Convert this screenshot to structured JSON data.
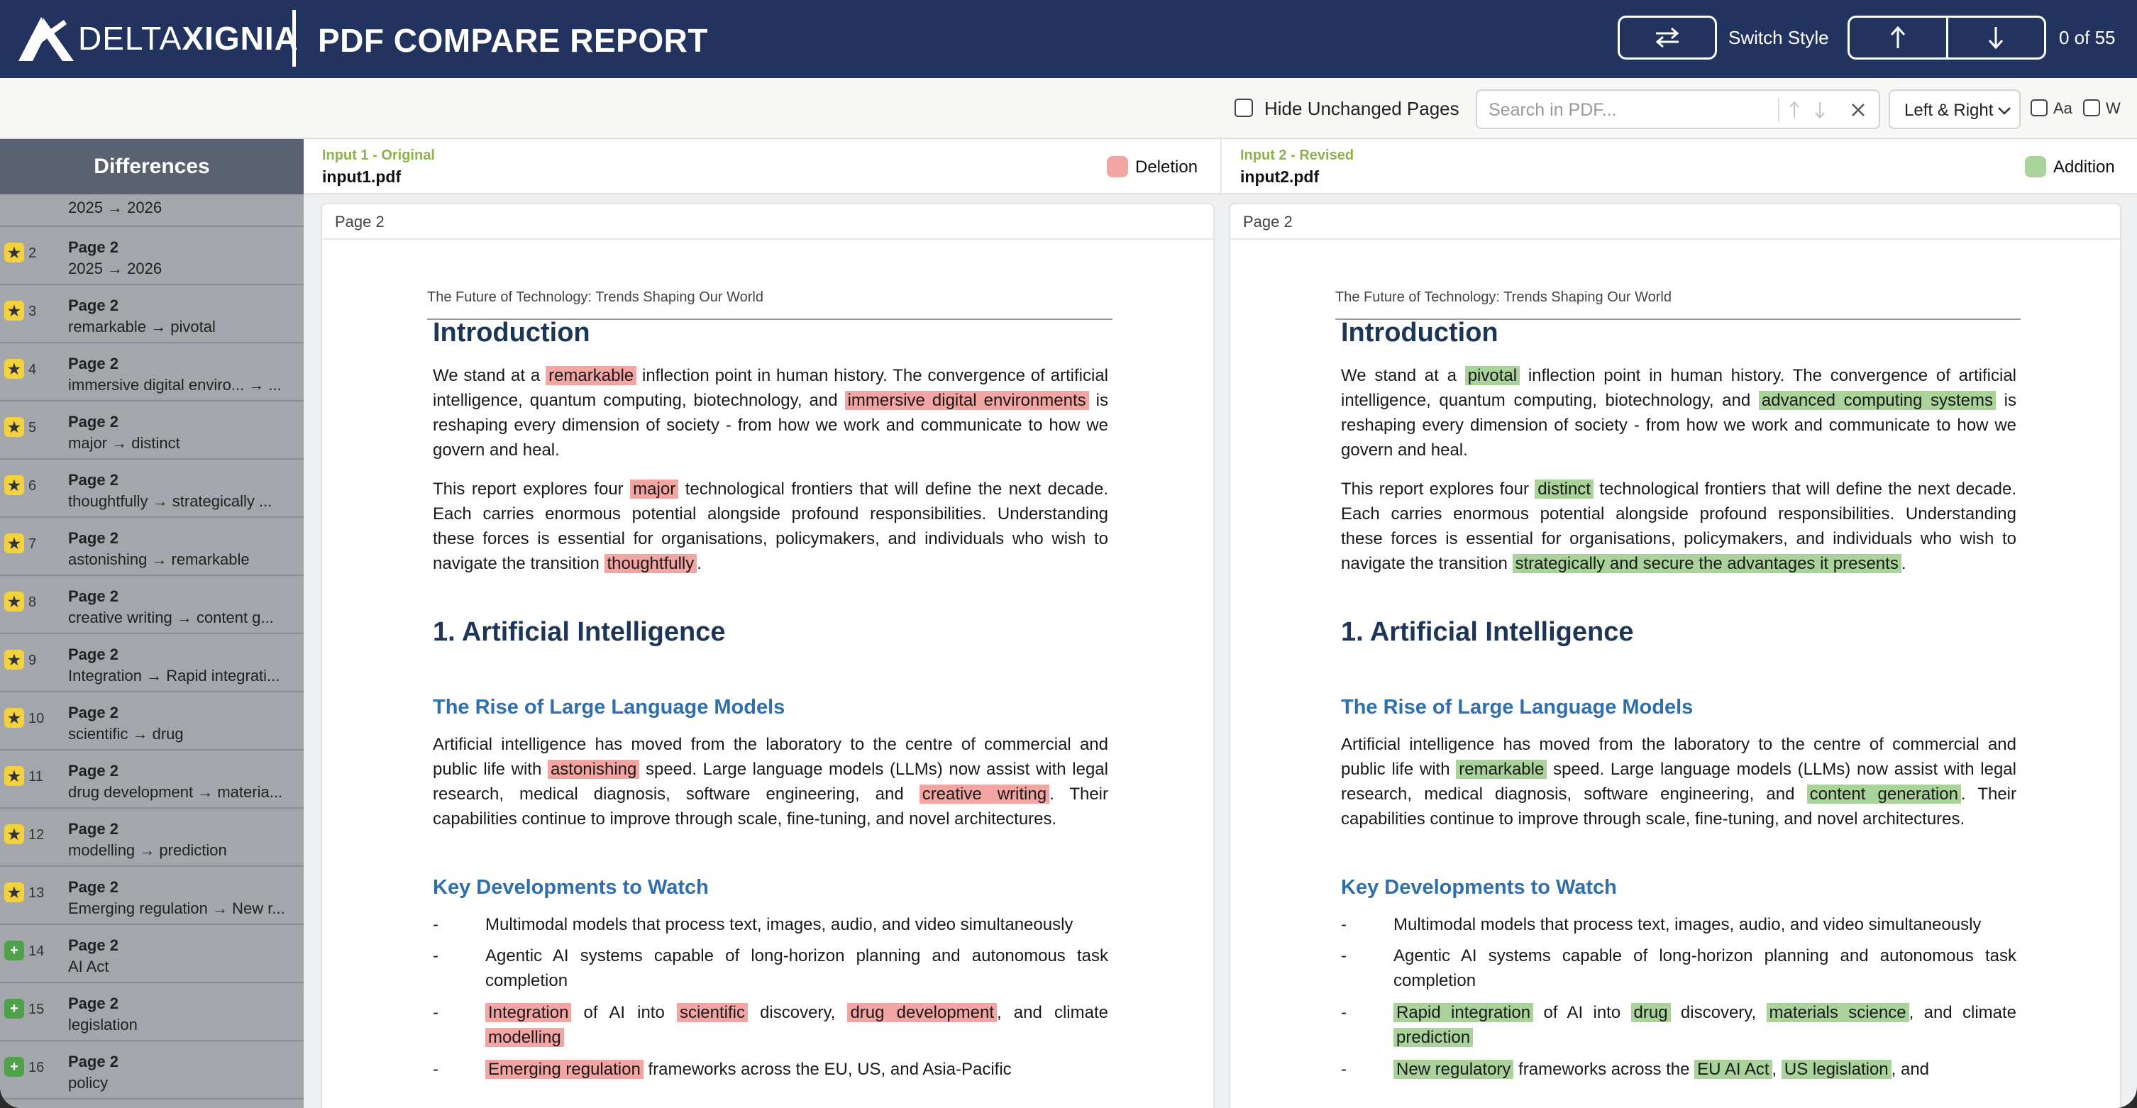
{
  "header": {
    "logo_light": "DELTA",
    "logo_bold": "XIGNIA",
    "title": "PDF COMPARE REPORT",
    "switch_style_label": "Switch Style",
    "counter": "0 of 55",
    "bg_color": "#23335f"
  },
  "toolbar": {
    "hide_unchanged_label": "Hide Unchanged Pages",
    "hide_unchanged_checked": false,
    "search_placeholder": "Search in PDF...",
    "view_mode": "Left & Right",
    "match_case_label": "Aa",
    "whole_word_label": "W"
  },
  "sidebar": {
    "title": "Differences",
    "cut_item_desc": "2025 → 2026",
    "items": [
      {
        "num": "2",
        "page": "Page 2",
        "desc": "2025 → 2026",
        "type": "change"
      },
      {
        "num": "3",
        "page": "Page 2",
        "desc": "remarkable → pivotal",
        "type": "change"
      },
      {
        "num": "4",
        "page": "Page 2",
        "desc": "immersive digital enviro... → ...",
        "type": "change"
      },
      {
        "num": "5",
        "page": "Page 2",
        "desc": "major → distinct",
        "type": "change"
      },
      {
        "num": "6",
        "page": "Page 2",
        "desc": "thoughtfully → strategically ...",
        "type": "change"
      },
      {
        "num": "7",
        "page": "Page 2",
        "desc": "astonishing → remarkable",
        "type": "change"
      },
      {
        "num": "8",
        "page": "Page 2",
        "desc": "creative writing → content g...",
        "type": "change"
      },
      {
        "num": "9",
        "page": "Page 2",
        "desc": "Integration → Rapid integrati...",
        "type": "change"
      },
      {
        "num": "10",
        "page": "Page 2",
        "desc": "scientific → drug",
        "type": "change"
      },
      {
        "num": "11",
        "page": "Page 2",
        "desc": "drug development → materia...",
        "type": "change"
      },
      {
        "num": "12",
        "page": "Page 2",
        "desc": "modelling → prediction",
        "type": "change"
      },
      {
        "num": "13",
        "page": "Page 2",
        "desc": "Emerging regulation → New r...",
        "type": "change"
      },
      {
        "num": "14",
        "page": "Page 2",
        "desc": "AI Act",
        "type": "add"
      },
      {
        "num": "15",
        "page": "Page 2",
        "desc": "legislation",
        "type": "add"
      },
      {
        "num": "16",
        "page": "Page 2",
        "desc": "policy",
        "type": "add"
      }
    ]
  },
  "left": {
    "label": "Input 1 - Original",
    "filename": "input1.pdf",
    "legend": "Deletion",
    "legend_color": "#f2a5a3",
    "page_tab": "Page 2"
  },
  "right": {
    "label": "Input 2 - Revised",
    "filename": "input2.pdf",
    "legend": "Addition",
    "legend_color": "#a9d39b",
    "page_tab": "Page 2"
  },
  "doc": {
    "running_header": "The Future of Technology: Trends Shaping Our World",
    "h_intro": "Introduction",
    "h_ai": "1. Artificial Intelligence",
    "h_llm": "The Rise of Large Language Models",
    "h_dev": "Key Developments to Watch",
    "p1_a": "We stand at a ",
    "p1_b": " inflection point in human history. The convergence of artificial intelligence, quantum computing, biotechnology, and ",
    "p1_c": " is reshaping every dimension of society - from how we work and communicate to how we govern and heal.",
    "p2_a": "This report explores four ",
    "p2_b": " technological frontiers that will define the next decade. Each carries enormous potential alongside profound responsibilities. Understanding these forces is essential for organisations, policymakers, and individuals who wish to navigate the transition ",
    "p2_c": ".",
    "p3_a": "Artificial intelligence has moved from the laboratory to the centre of commercial and public life with ",
    "p3_b": " speed. Large language models (LLMs) now assist with legal research, medical diagnosis, software engineering, and ",
    "p3_c": ". Their capabilities continue to improve through scale, fine-tuning, and novel architectures.",
    "dash": "-",
    "li1": "Multimodal models that process text, images, audio, and video simultaneously",
    "li2": "Agentic AI systems capable of long-horizon planning and autonomous task completion",
    "li3_a": " of AI into ",
    "li3_b": " discovery, ",
    "li3_c": ", and climate ",
    "li4_tail_left": " frameworks across the EU, US, and Asia-Pacific",
    "li4_mid_right_a": " frameworks across the ",
    "li4_mid_right_b": ", ",
    "li4_mid_right_c": ", and",
    "old": {
      "w1": "remarkable",
      "w2": "immersive digital environments",
      "w3": "major",
      "w4": "thoughtfully",
      "w5": "astonishing",
      "w6": "creative writing",
      "w7": "Integration",
      "w8": "scientific",
      "w9": "drug development",
      "w10": "modelling",
      "w11": "Emerging regulation"
    },
    "new": {
      "w1": "pivotal",
      "w2": "advanced computing systems",
      "w3": "distinct",
      "w4": "strategically and secure the advantages it presents",
      "w5": "remarkable",
      "w6": "content generation",
      "w7": "Rapid integration",
      "w8": "drug",
      "w9": "materials science",
      "w10": "prediction",
      "w11": "New regulatory",
      "w12": "EU AI Act",
      "w13": "US legislation"
    }
  }
}
